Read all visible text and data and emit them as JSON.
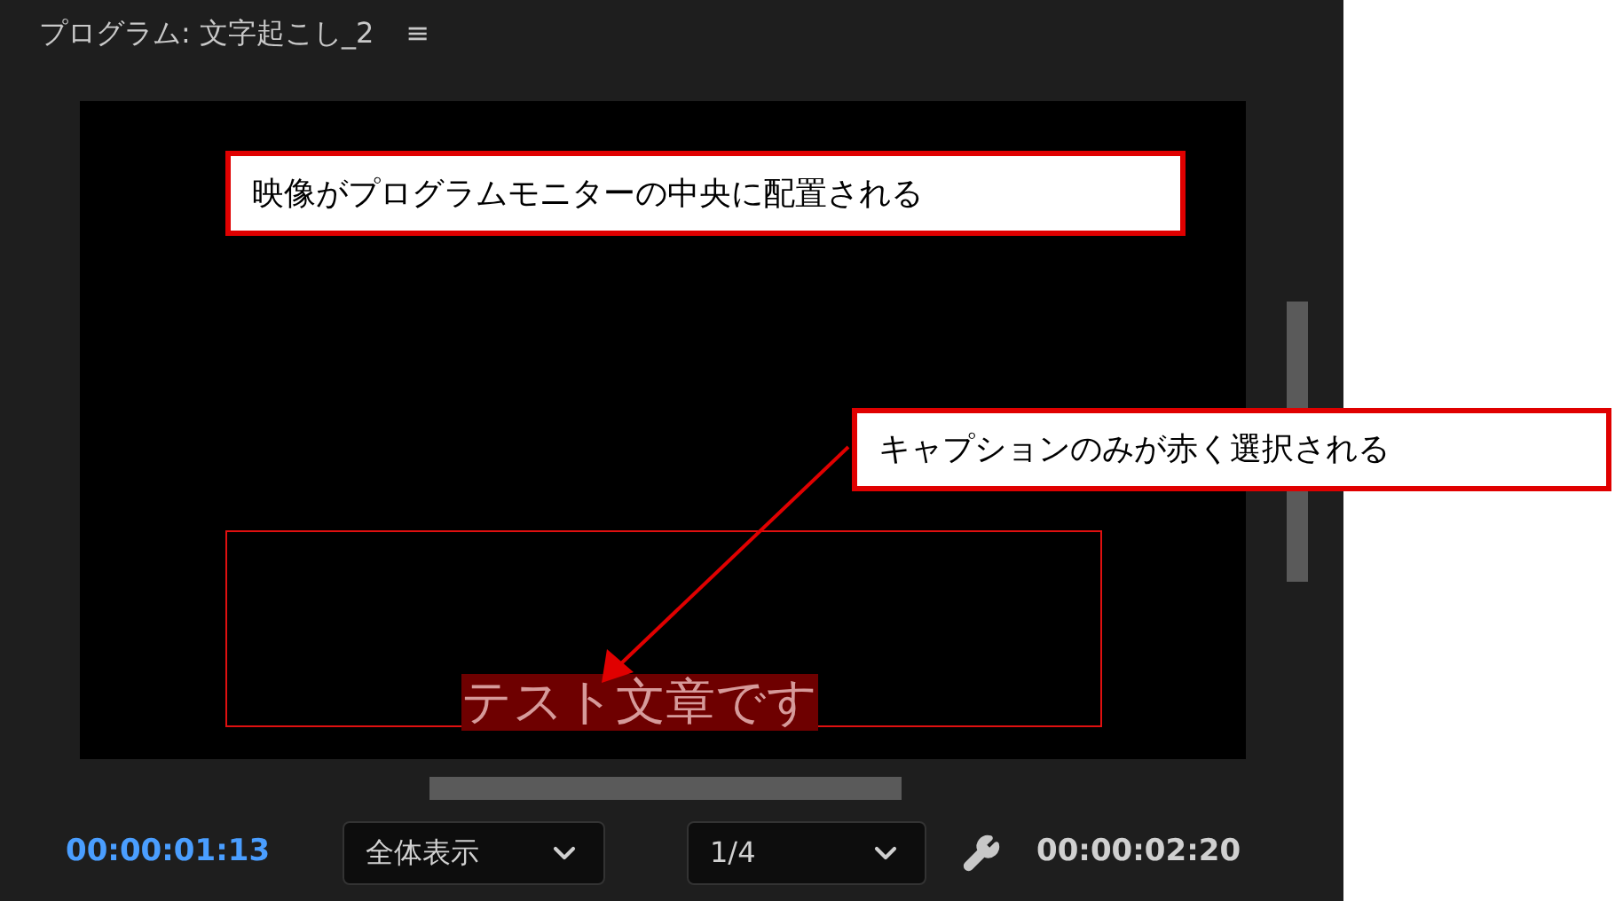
{
  "panel": {
    "title": "プログラム: 文字起こし_2",
    "menu_icon": "≡"
  },
  "monitor": {
    "caption": {
      "text": "テスト文章です",
      "selected": true
    }
  },
  "controls": {
    "current_time": "00:00:01:13",
    "zoom": "全体表示",
    "resolution": "1/4",
    "duration": "00:00:02:20"
  },
  "annotations": [
    {
      "text": "映像がプログラムモニターの中央に配置される"
    },
    {
      "text": "キャプションのみが赤く選択される"
    }
  ]
}
